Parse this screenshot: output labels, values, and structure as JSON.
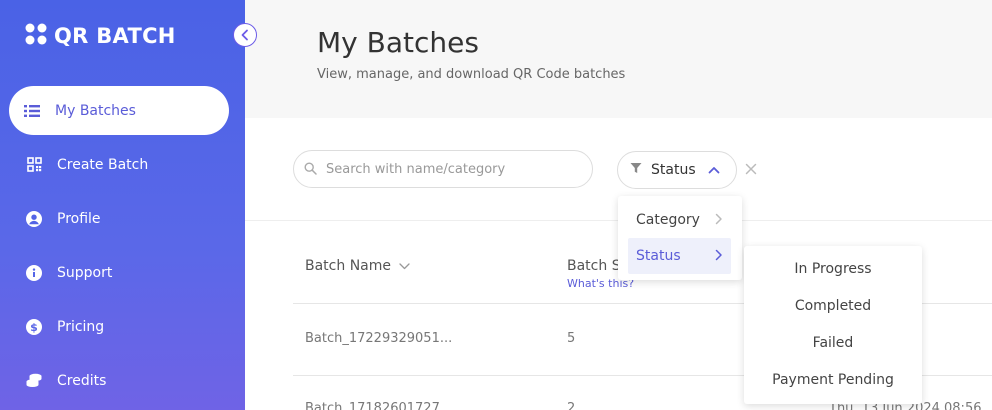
{
  "app": {
    "name": "QR BATCH"
  },
  "sidebar": {
    "items": [
      {
        "label": "My Batches",
        "icon": "list-icon"
      },
      {
        "label": "Create Batch",
        "icon": "qr-code-icon"
      },
      {
        "label": "Profile",
        "icon": "user-circle-icon"
      },
      {
        "label": "Support",
        "icon": "info-icon"
      },
      {
        "label": "Pricing",
        "icon": "dollar-icon"
      },
      {
        "label": "Credits",
        "icon": "coins-icon"
      }
    ]
  },
  "header": {
    "title": "My Batches",
    "subtitle": "View, manage, and download QR Code batches"
  },
  "filters": {
    "search_placeholder": "Search with name/category",
    "status_label": "Status"
  },
  "filter_menu": {
    "items": [
      {
        "label": "Category"
      },
      {
        "label": "Status"
      }
    ]
  },
  "status_menu": {
    "items": [
      "In Progress",
      "Completed",
      "Failed",
      "Payment Pending"
    ]
  },
  "table": {
    "columns": [
      {
        "label": "Batch Name"
      },
      {
        "label": "Batch S",
        "sublabel": "What's this?"
      }
    ],
    "rows": [
      {
        "name": "Batch_17229329051...",
        "size": "5"
      },
      {
        "name": "Batch_17182601727...",
        "size": "2",
        "date": "Thu, 13 Jun 2024 08:56"
      }
    ]
  },
  "colors": {
    "accent": "#5a5cd8",
    "sidebar_gradient_start": "#4a62e6",
    "sidebar_gradient_end": "#6f63e6"
  }
}
